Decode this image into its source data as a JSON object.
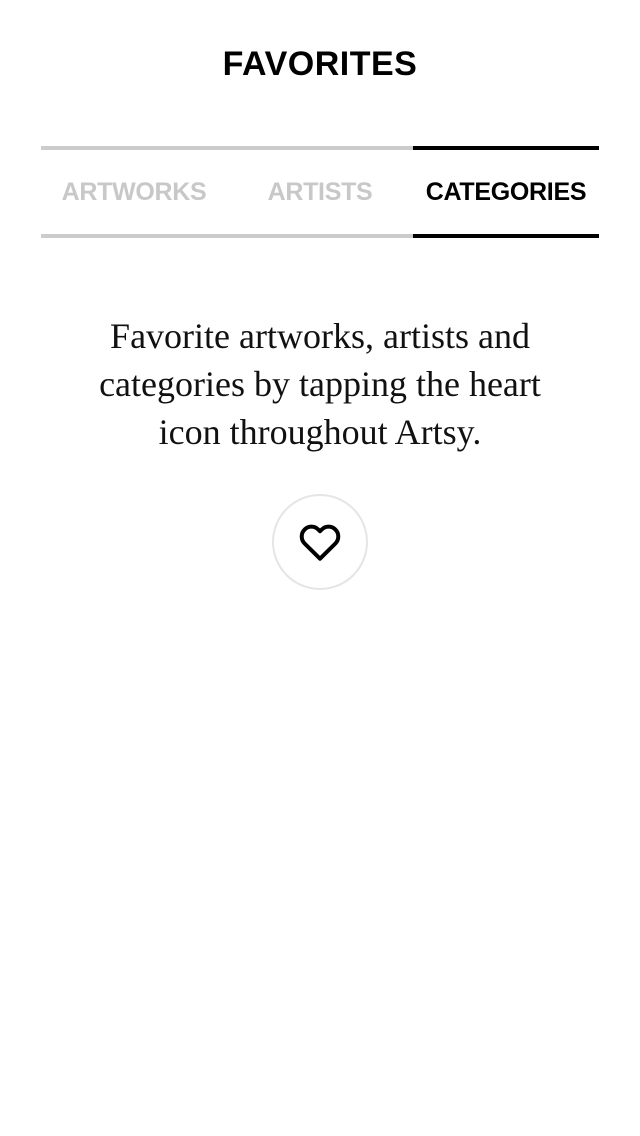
{
  "header": {
    "title": "FAVORITES"
  },
  "tabs": [
    {
      "label": "ARTWORKS",
      "active": false
    },
    {
      "label": "ARTISTS",
      "active": false
    },
    {
      "label": "CATEGORIES",
      "active": true
    }
  ],
  "empty_state": {
    "message": "Favorite artworks, artists and categories by tapping the heart icon throughout Artsy.",
    "icon": "heart-icon"
  },
  "colors": {
    "active": "#000000",
    "inactive": "#c8c8c8",
    "circle_border": "#e5e5e5"
  }
}
